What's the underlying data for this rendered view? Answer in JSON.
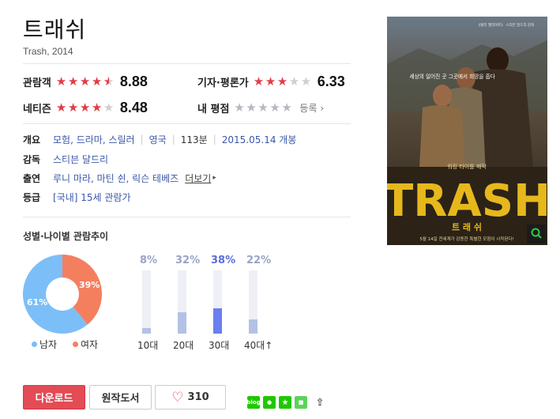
{
  "movie": {
    "title": "트래쉬",
    "subtitle": "Trash, 2014"
  },
  "ratings": {
    "audience": {
      "label": "관람객",
      "score": "8.88",
      "stars": 4.5
    },
    "critic": {
      "label": "기자·평론가",
      "score": "6.33",
      "stars": 3
    },
    "netizen": {
      "label": "네티즌",
      "score": "8.48",
      "stars": 4
    },
    "mine": {
      "label": "내 평점",
      "register": "등록",
      "stars": 0
    }
  },
  "info": {
    "overview_label": "개요",
    "genres": "모험, 드라마, 스릴러",
    "country": "영국",
    "runtime": "113분",
    "release": "2015.05.14 개봉",
    "director_label": "감독",
    "director": "스티븐 달드리",
    "cast_label": "출연",
    "cast": "루니 마라, 마틴 쉰, 릭슨 테베즈",
    "more": "더보기",
    "grade_label": "등급",
    "grade": "[국내] 15세 관람가"
  },
  "stats": {
    "title": "성별·나이별 관람추이",
    "male_pct": "61%",
    "female_pct": "39%",
    "male_value": 61,
    "female_value": 39,
    "male_label": "남자",
    "female_label": "여자",
    "male_color": "#7cbef8",
    "female_color": "#f47f5f",
    "ages": [
      {
        "label": "10대",
        "pct": "8%",
        "value": 8
      },
      {
        "label": "20대",
        "pct": "32%",
        "value": 32
      },
      {
        "label": "30대",
        "pct": "38%",
        "value": 38
      },
      {
        "label": "40대↑",
        "pct": "22%",
        "value": 22
      }
    ]
  },
  "actions": {
    "download": "다운로드",
    "original": "원작도서",
    "likes": "310"
  },
  "share": {
    "blog": "blog"
  },
  "poster": {
    "tagline": "세상의 일어진 곳 그곳에서 희망을 줍다",
    "top_text": "《빌리 엘리어트》 스티븐 달드리 감독",
    "maker": "워킹 타이틀 제작",
    "logo": "TRASH",
    "logo_kr": "트 래 쉬",
    "bottom": "5월 14일 전세계가 감동한 특별한 모험이 시작된다!"
  }
}
